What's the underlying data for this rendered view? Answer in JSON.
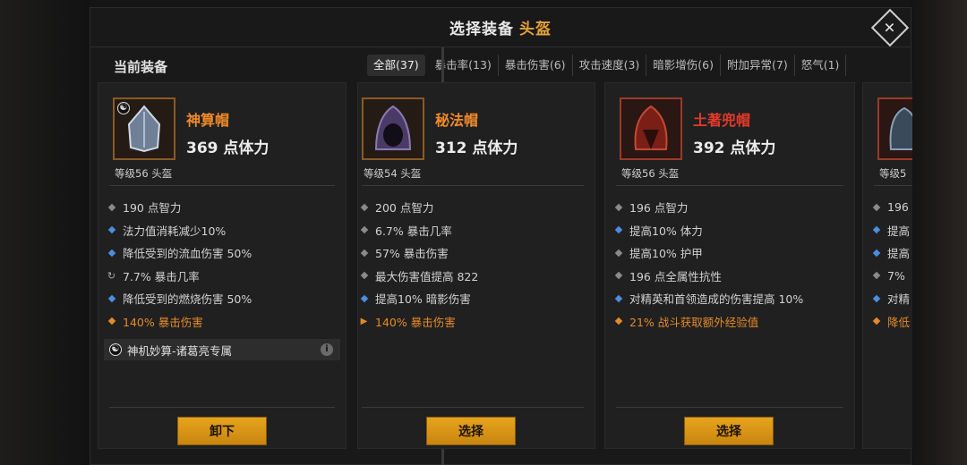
{
  "title": {
    "text": "选择装备",
    "accent": "头盔"
  },
  "current_header": "当前装备",
  "tabs": [
    {
      "label": "全部(37)",
      "active": true
    },
    {
      "label": "暴击率(13)"
    },
    {
      "label": "暴击伤害(6)"
    },
    {
      "label": "攻击速度(3)"
    },
    {
      "label": "暗影增伤(6)"
    },
    {
      "label": "附加异常(7)"
    },
    {
      "label": "怒气(1)"
    }
  ],
  "cards": [
    {
      "name": "神算帽",
      "stat": "369 点体力",
      "level": "等级56 头盔",
      "affixes": [
        {
          "text": "190 点智力",
          "bullet": "gray"
        },
        {
          "text": "法力值消耗减少10%",
          "bullet": "blue"
        },
        {
          "text": "降低受到的流血伤害 50%",
          "bullet": "blue"
        },
        {
          "text": "7.7% 暴击几率",
          "bullet": "cycle"
        },
        {
          "text": "降低受到的燃烧伤害 50%",
          "bullet": "blue"
        },
        {
          "text": "140% 暴击伤害",
          "bullet": "orange"
        }
      ],
      "set_text": "神机妙算-诸葛亮专属",
      "button": "卸下"
    },
    {
      "name": "秘法帽",
      "stat": "312 点体力",
      "level": "等级54 头盔",
      "affixes": [
        {
          "text": "200 点智力",
          "bullet": "gray"
        },
        {
          "text": "6.7% 暴击几率",
          "bullet": "gray"
        },
        {
          "text": "57% 暴击伤害",
          "bullet": "gray"
        },
        {
          "text": "最大伤害值提高 822",
          "bullet": "gray"
        },
        {
          "text": "提高10% 暗影伤害",
          "bullet": "blue"
        },
        {
          "text": "140% 暴击伤害",
          "bullet": "arrow"
        }
      ],
      "button": "选择"
    },
    {
      "name": "土著兜帽",
      "stat": "392 点体力",
      "level": "等级56 头盔",
      "affixes": [
        {
          "text": "196 点智力",
          "bullet": "gray"
        },
        {
          "text": "提高10% 体力",
          "bullet": "blue"
        },
        {
          "text": "提高10% 护甲",
          "bullet": "gray"
        },
        {
          "text": "196 点全属性抗性",
          "bullet": "gray"
        },
        {
          "text": "对精英和首领造成的伤害提高 10%",
          "bullet": "blue"
        },
        {
          "text": "21% 战斗获取额外经验值",
          "bullet": "orange"
        }
      ],
      "button": "选择"
    },
    {
      "level": "等级5",
      "affixes": [
        {
          "text": "196",
          "bullet": "gray"
        },
        {
          "text": "提高",
          "bullet": "blue"
        },
        {
          "text": "提高",
          "bullet": "blue"
        },
        {
          "text": "7%",
          "bullet": "gray"
        },
        {
          "text": "对精",
          "bullet": "blue"
        },
        {
          "text": "降低",
          "bullet": "orange"
        }
      ]
    }
  ]
}
